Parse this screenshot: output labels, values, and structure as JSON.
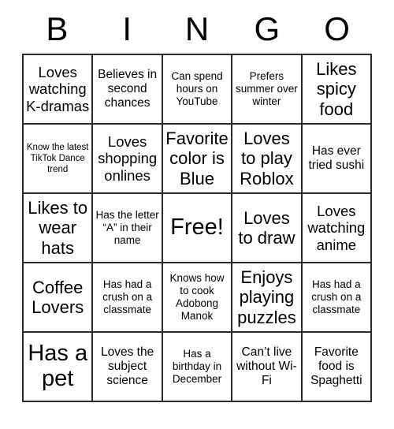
{
  "card": {
    "header_letters": [
      "B",
      "I",
      "N",
      "G",
      "O"
    ],
    "colors": {
      "page_background": "#ffffff",
      "cell_background": "#ffffff",
      "border": "#2b2b2b",
      "text": "#000000"
    },
    "rows": [
      [
        {
          "text": "Loves watching K-dramas",
          "size": "fs-lg"
        },
        {
          "text": "Believes in second chances",
          "size": "fs-md"
        },
        {
          "text": "Can spend hours on YouTube",
          "size": "fs-sm"
        },
        {
          "text": "Prefers summer over winter",
          "size": "fs-sm"
        },
        {
          "text": "Likes spicy food",
          "size": "fs-xl"
        }
      ],
      [
        {
          "text": "Know the latest TikTok Dance trend",
          "size": "fs-xs"
        },
        {
          "text": "Loves shopping onlines",
          "size": "fs-lg"
        },
        {
          "text": "Favorite color is Blue",
          "size": "fs-xl"
        },
        {
          "text": "Loves to play Roblox",
          "size": "fs-xl"
        },
        {
          "text": "Has ever tried sushi",
          "size": "fs-md"
        }
      ],
      [
        {
          "text": "Likes to wear hats",
          "size": "fs-xl"
        },
        {
          "text": "Has the letter “A” in their name",
          "size": "fs-sm"
        },
        {
          "text": "Free!",
          "size": "fs-xxl"
        },
        {
          "text": "Loves to draw",
          "size": "fs-xl"
        },
        {
          "text": "Loves watching anime",
          "size": "fs-lg"
        }
      ],
      [
        {
          "text": "Coffee Lovers",
          "size": "fs-xl"
        },
        {
          "text": "Has had a crush on a classmate",
          "size": "fs-sm"
        },
        {
          "text": "Knows how to cook Adobong Manok",
          "size": "fs-sm"
        },
        {
          "text": "Enjoys playing puzzles",
          "size": "fs-xl"
        },
        {
          "text": "Has had a crush on a classmate",
          "size": "fs-sm"
        }
      ],
      [
        {
          "text": "Has a pet",
          "size": "fs-xxl"
        },
        {
          "text": "Loves the subject science",
          "size": "fs-md"
        },
        {
          "text": "Has a birthday in December",
          "size": "fs-sm"
        },
        {
          "text": "Can’t live without Wi-Fi",
          "size": "fs-md"
        },
        {
          "text": "Favorite food is Spaghetti",
          "size": "fs-md"
        }
      ]
    ]
  }
}
